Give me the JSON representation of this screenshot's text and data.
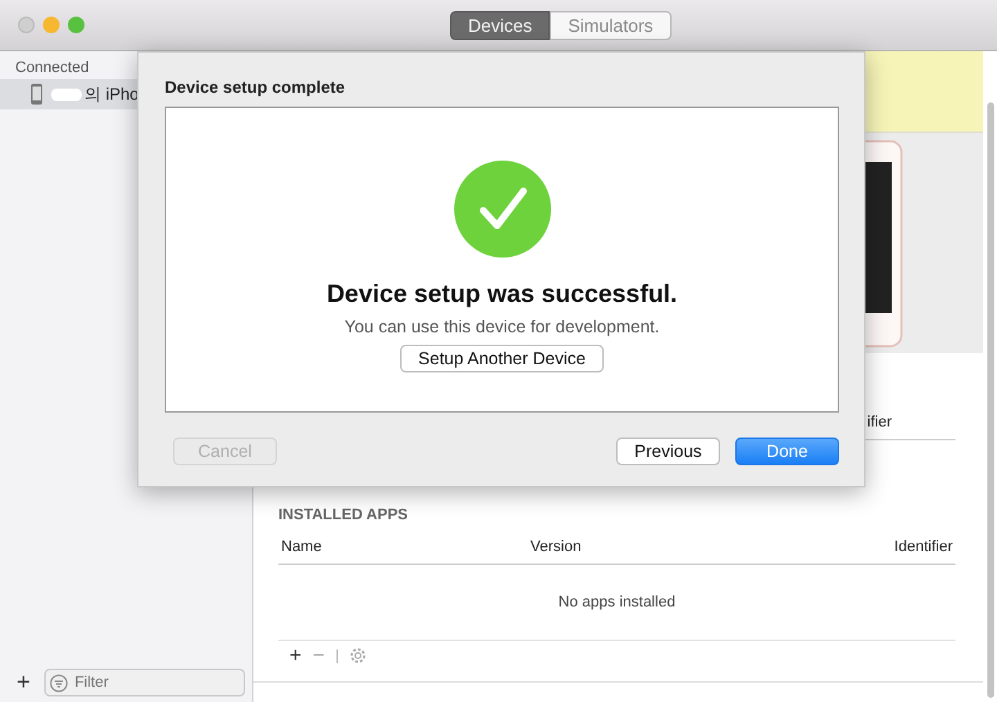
{
  "window": {
    "tabs": [
      {
        "label": "Devices",
        "selected": true
      },
      {
        "label": "Simulators",
        "selected": false
      }
    ]
  },
  "sidebar": {
    "section": "Connected",
    "items": [
      {
        "label": "의 iPho",
        "selected": true
      }
    ],
    "add_button": "+",
    "filter": {
      "placeholder": "Filter"
    }
  },
  "device_panel": {
    "identifier_header": "ifier"
  },
  "installed_apps": {
    "title": "INSTALLED APPS",
    "columns": [
      "Name",
      "Version",
      "Identifier"
    ],
    "empty_text": "No apps installed",
    "add": "+",
    "remove": "−"
  },
  "sheet": {
    "title": "Device setup complete",
    "kind": "success",
    "heading": "Device setup was successful.",
    "message": "You can use this device for development.",
    "action": "Setup Another Device",
    "buttons": [
      {
        "label": "Cancel",
        "disabled": true,
        "kind": "plain"
      },
      {
        "label": "Previous",
        "disabled": false,
        "kind": "plain"
      },
      {
        "label": "Done",
        "disabled": false,
        "kind": "default"
      }
    ]
  }
}
